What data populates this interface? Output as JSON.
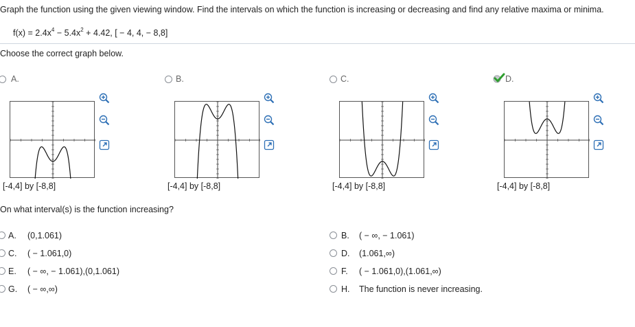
{
  "instruction": "Graph the function using the given viewing window. Find the intervals on which the function is increasing or decreasing and find any relative maxima or minima.",
  "function": {
    "prefix": "f(x) = 2.4x",
    "exp1": "4",
    "mid": " − 5.4x",
    "exp2": "2",
    "suffix": " + 4.42, [ − 4, 4, − 8,8]"
  },
  "choose_prompt": "Choose the correct graph below.",
  "graph_options": [
    {
      "letter": "A.",
      "window": "[-4,4] by [-8,8]",
      "selected": false
    },
    {
      "letter": "B.",
      "window": "[-4,4] by [-8,8]",
      "selected": false
    },
    {
      "letter": "C.",
      "window": "[-4,4] by [-8,8]",
      "selected": false
    },
    {
      "letter": "D.",
      "window": "[-4,4] by [-8,8]",
      "selected": true
    }
  ],
  "question": "On what interval(s) is the function increasing?",
  "answers": [
    {
      "letter": "A.",
      "text": "(0,1.061)"
    },
    {
      "letter": "B.",
      "text": "( − ∞, − 1.061)"
    },
    {
      "letter": "C.",
      "text": "( − 1.061,0)"
    },
    {
      "letter": "D.",
      "text": "(1.061,∞)"
    },
    {
      "letter": "E.",
      "text": "( − ∞, − 1.061),(0,1.061)"
    },
    {
      "letter": "F.",
      "text": "( − 1.061,0),(1.061,∞)"
    },
    {
      "letter": "G.",
      "text": "( − ∞,∞)"
    },
    {
      "letter": "H.",
      "text": "The function is never increasing."
    }
  ],
  "icons": {
    "zoom_in": "zoom-in-icon",
    "zoom_out": "zoom-out-icon",
    "enlarge": "enlarge-icon",
    "correct": "checkmark-icon"
  },
  "colors": {
    "accent": "#2d6fb5",
    "correct": "#2f9e2f",
    "rule": "#cfd6df"
  }
}
